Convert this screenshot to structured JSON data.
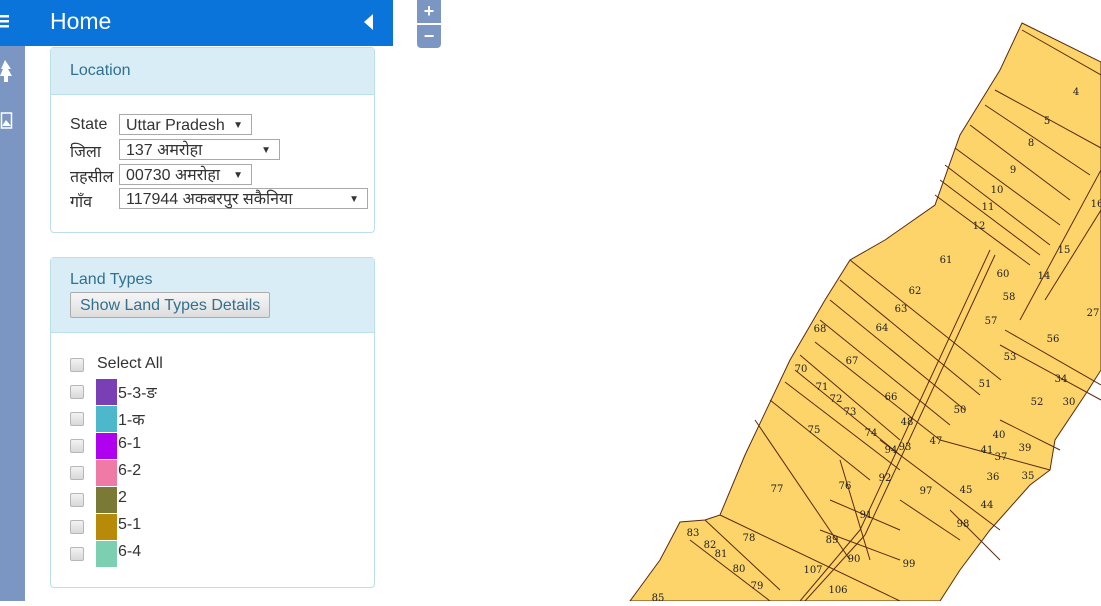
{
  "header": {
    "title": "Home",
    "menu_icon": "hamburger-icon",
    "collapse_icon": "caret-left-icon"
  },
  "rail": {
    "icons": [
      "tree-icon",
      "image-icon"
    ]
  },
  "location": {
    "title": "Location",
    "fields": [
      {
        "label": "State",
        "value": "Uttar Pradesh"
      },
      {
        "label": "जिला",
        "value": "137 अमरोहा"
      },
      {
        "label": "तहसील",
        "value": "00730 अमरोहा"
      },
      {
        "label": "गाँव",
        "value": "117944 अकबरपुर सकैनिया"
      }
    ]
  },
  "land_types": {
    "title": "Land Types",
    "details_button": "Show Land Types Details",
    "select_all": "Select All",
    "items": [
      {
        "label": "5-3-ङ",
        "color": "#7b3fb5",
        "checked": false
      },
      {
        "label": "1-क",
        "color": "#4db8cc",
        "checked": false
      },
      {
        "label": "6-1",
        "color": "#b000f0",
        "checked": false
      },
      {
        "label": "6-2",
        "color": "#f07aa6",
        "checked": false
      },
      {
        "label": "2",
        "color": "#7a7a36",
        "checked": false
      },
      {
        "label": "5-1",
        "color": "#b88a0a",
        "checked": false
      },
      {
        "label": "6-4",
        "color": "#7ccfb0",
        "checked": false
      }
    ]
  },
  "map": {
    "zoom_in": "+",
    "zoom_out": "−",
    "parcel_fill": "#fcd46a",
    "parcel_stroke": "#5a2a10",
    "parcel_labels": [
      "4",
      "5",
      "8",
      "9",
      "10",
      "11",
      "12",
      "14",
      "15",
      "16",
      "27",
      "30",
      "34",
      "35",
      "36",
      "37",
      "39",
      "40",
      "41",
      "44",
      "45",
      "47",
      "48",
      "50",
      "51",
      "52",
      "53",
      "56",
      "57",
      "58",
      "60",
      "61",
      "62",
      "63",
      "64",
      "66",
      "67",
      "68",
      "70",
      "71",
      "72",
      "73",
      "74",
      "75",
      "76",
      "77",
      "78",
      "79",
      "80",
      "81",
      "82",
      "83",
      "85",
      "89",
      "90",
      "91",
      "92",
      "93",
      "94",
      "97",
      "98",
      "99",
      "106",
      "107"
    ]
  }
}
